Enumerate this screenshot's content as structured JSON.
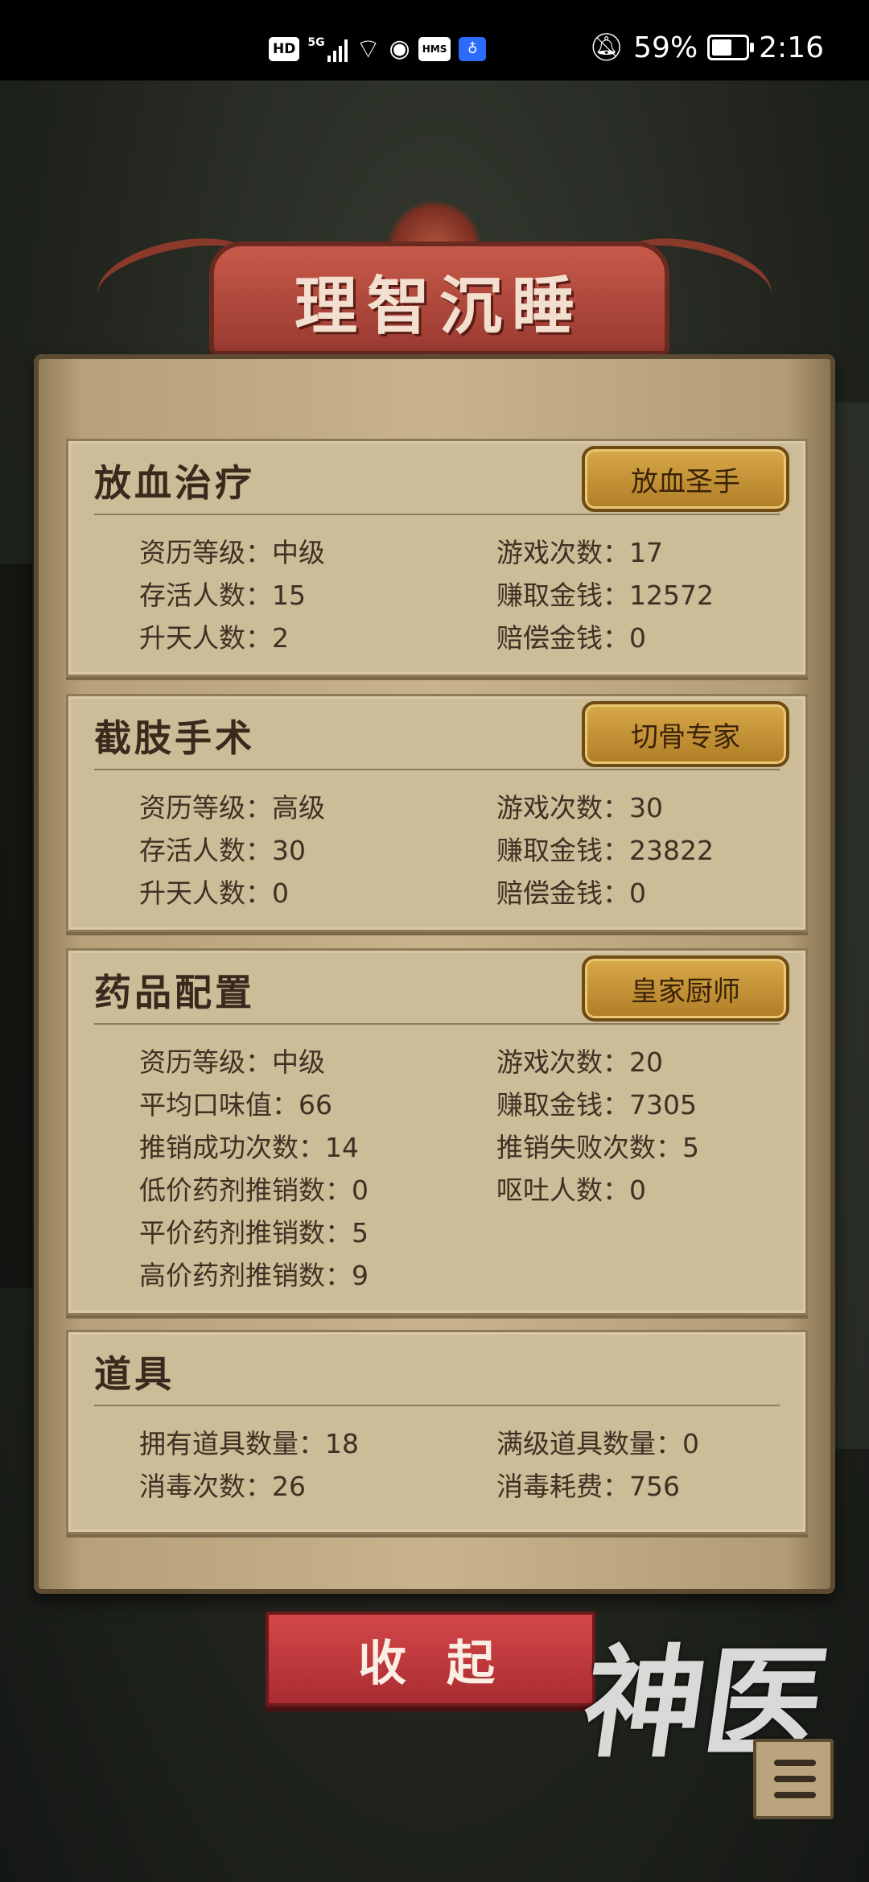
{
  "status_bar": {
    "hd": "HD",
    "signal": "5G",
    "hms": "HMS",
    "battery": "59%",
    "battery_level": 0.59,
    "time": "2:16"
  },
  "title": "理智沉睡",
  "sections": [
    {
      "title": "放血治疗",
      "badge": "放血圣手",
      "stats": [
        {
          "label": "资历等级：",
          "value": "中级"
        },
        {
          "label": "游戏次数：",
          "value": "17"
        },
        {
          "label": "存活人数：",
          "value": "15"
        },
        {
          "label": "赚取金钱：",
          "value": "12572"
        },
        {
          "label": "升天人数：",
          "value": "2"
        },
        {
          "label": "赔偿金钱：",
          "value": "0"
        }
      ]
    },
    {
      "title": "截肢手术",
      "badge": "切骨专家",
      "stats": [
        {
          "label": "资历等级：",
          "value": "高级"
        },
        {
          "label": "游戏次数：",
          "value": "30"
        },
        {
          "label": "存活人数：",
          "value": "30"
        },
        {
          "label": "赚取金钱：",
          "value": "23822"
        },
        {
          "label": "升天人数：",
          "value": "0"
        },
        {
          "label": "赔偿金钱：",
          "value": "0"
        }
      ]
    },
    {
      "title": "药品配置",
      "badge": "皇家厨师",
      "stats": [
        {
          "label": "资历等级：",
          "value": "中级"
        },
        {
          "label": "游戏次数：",
          "value": "20"
        },
        {
          "label": "平均口味值：",
          "value": "66"
        },
        {
          "label": "赚取金钱：",
          "value": "7305"
        },
        {
          "label": "推销成功次数：",
          "value": "14"
        },
        {
          "label": "推销失败次数：",
          "value": "5"
        },
        {
          "label": "低价药剂推销数：",
          "value": "0"
        },
        {
          "label": "呕吐人数：",
          "value": "0"
        },
        {
          "label": "平价药剂推销数：",
          "value": "5"
        },
        {
          "label": "高价药剂推销数：",
          "value": "9"
        }
      ]
    },
    {
      "title": "道具",
      "stats": [
        {
          "label": "拥有道具数量：",
          "value": "18"
        },
        {
          "label": "满级道具数量：",
          "value": "0"
        },
        {
          "label": "消毒次数：",
          "value": "26"
        },
        {
          "label": "消毒耗费：",
          "value": "756"
        }
      ]
    }
  ],
  "collapse_button": "收起",
  "logo": "神医"
}
